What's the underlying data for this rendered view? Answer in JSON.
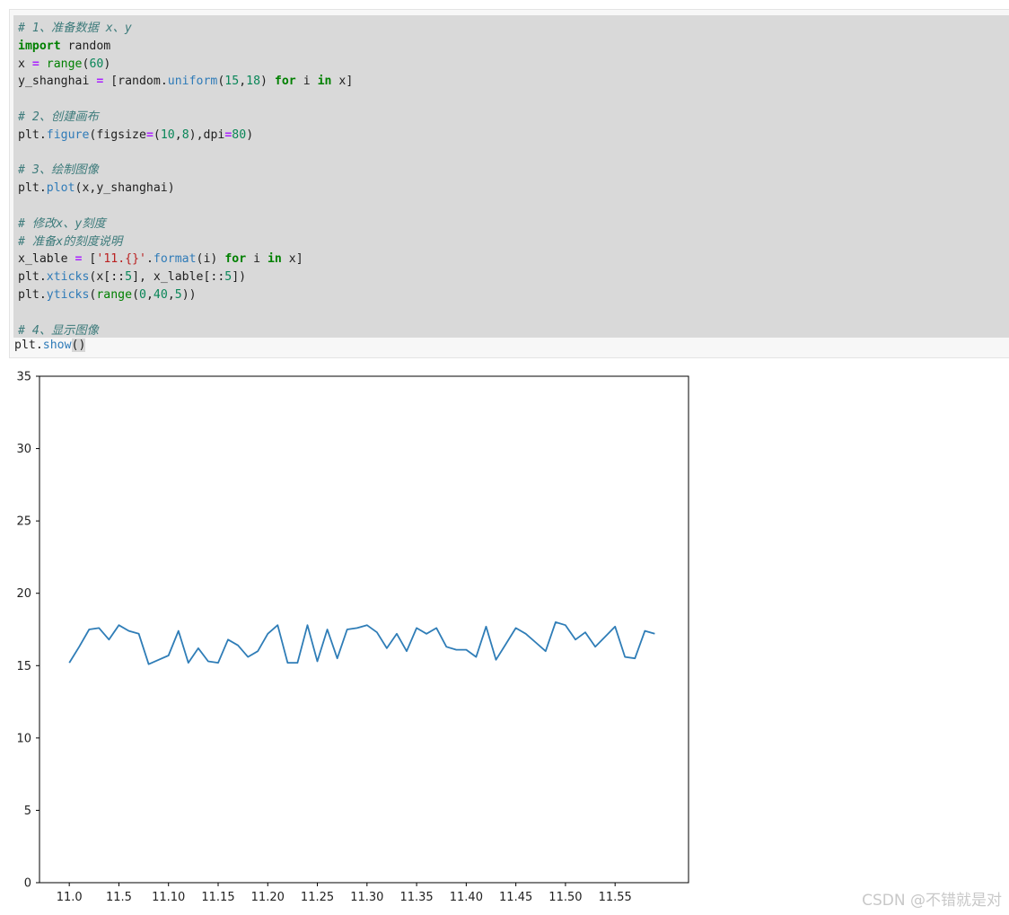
{
  "code_cell": {
    "lines": [
      [
        {
          "c": "com",
          "t": "# 1、准备数据 x、y"
        }
      ],
      [
        {
          "c": "kw",
          "t": "import"
        },
        {
          "c": "txt",
          "t": " random"
        }
      ],
      [
        {
          "c": "txt",
          "t": "x "
        },
        {
          "c": "op",
          "t": "="
        },
        {
          "c": "txt",
          "t": " "
        },
        {
          "c": "kw-plain",
          "t": "range"
        },
        {
          "c": "txt",
          "t": "("
        },
        {
          "c": "num",
          "t": "60"
        },
        {
          "c": "txt",
          "t": ")"
        }
      ],
      [
        {
          "c": "txt",
          "t": "y_shanghai "
        },
        {
          "c": "op",
          "t": "="
        },
        {
          "c": "txt",
          "t": " [random."
        },
        {
          "c": "fn",
          "t": "uniform"
        },
        {
          "c": "txt",
          "t": "("
        },
        {
          "c": "num",
          "t": "15"
        },
        {
          "c": "txt",
          "t": ","
        },
        {
          "c": "num",
          "t": "18"
        },
        {
          "c": "txt",
          "t": ") "
        },
        {
          "c": "kw",
          "t": "for"
        },
        {
          "c": "txt",
          "t": " i "
        },
        {
          "c": "kw",
          "t": "in"
        },
        {
          "c": "txt",
          "t": " x]"
        }
      ],
      [],
      [
        {
          "c": "com",
          "t": "# 2、创建画布"
        }
      ],
      [
        {
          "c": "txt",
          "t": "plt."
        },
        {
          "c": "fn",
          "t": "figure"
        },
        {
          "c": "txt",
          "t": "(figsize"
        },
        {
          "c": "op",
          "t": "="
        },
        {
          "c": "txt",
          "t": "("
        },
        {
          "c": "num",
          "t": "10"
        },
        {
          "c": "txt",
          "t": ","
        },
        {
          "c": "num",
          "t": "8"
        },
        {
          "c": "txt",
          "t": "),dpi"
        },
        {
          "c": "op",
          "t": "="
        },
        {
          "c": "num",
          "t": "80"
        },
        {
          "c": "txt",
          "t": ")"
        }
      ],
      [],
      [
        {
          "c": "com",
          "t": "# 3、绘制图像"
        }
      ],
      [
        {
          "c": "txt",
          "t": "plt."
        },
        {
          "c": "fn",
          "t": "plot"
        },
        {
          "c": "txt",
          "t": "(x,y_shanghai)"
        }
      ],
      [],
      [
        {
          "c": "com",
          "t": "# 修改x、y刻度"
        }
      ],
      [
        {
          "c": "com",
          "t": "# 准备x的刻度说明"
        }
      ],
      [
        {
          "c": "txt",
          "t": "x_lable "
        },
        {
          "c": "op",
          "t": "="
        },
        {
          "c": "txt",
          "t": " ["
        },
        {
          "c": "str",
          "t": "'11.{}'"
        },
        {
          "c": "txt",
          "t": "."
        },
        {
          "c": "fn",
          "t": "format"
        },
        {
          "c": "txt",
          "t": "(i) "
        },
        {
          "c": "kw",
          "t": "for"
        },
        {
          "c": "txt",
          "t": " i "
        },
        {
          "c": "kw",
          "t": "in"
        },
        {
          "c": "txt",
          "t": " x]"
        }
      ],
      [
        {
          "c": "txt",
          "t": "plt."
        },
        {
          "c": "fn",
          "t": "xticks"
        },
        {
          "c": "txt",
          "t": "(x[::"
        },
        {
          "c": "num",
          "t": "5"
        },
        {
          "c": "txt",
          "t": "], x_lable[::"
        },
        {
          "c": "num",
          "t": "5"
        },
        {
          "c": "txt",
          "t": "])"
        }
      ],
      [
        {
          "c": "txt",
          "t": "plt."
        },
        {
          "c": "fn",
          "t": "yticks"
        },
        {
          "c": "txt",
          "t": "("
        },
        {
          "c": "kw-plain",
          "t": "range"
        },
        {
          "c": "txt",
          "t": "("
        },
        {
          "c": "num",
          "t": "0"
        },
        {
          "c": "txt",
          "t": ","
        },
        {
          "c": "num",
          "t": "40"
        },
        {
          "c": "txt",
          "t": ","
        },
        {
          "c": "num",
          "t": "5"
        },
        {
          "c": "txt",
          "t": "))"
        }
      ],
      [],
      [
        {
          "c": "com",
          "t": "# 4、显示图像"
        }
      ]
    ],
    "last_line": [
      {
        "c": "txt",
        "t": "plt."
      },
      {
        "c": "fn",
        "t": "show"
      },
      {
        "c": "bracket",
        "t": "()"
      }
    ]
  },
  "chart_data": {
    "type": "line",
    "title": "",
    "xlabel": "",
    "ylabel": "",
    "x": [
      0,
      1,
      2,
      3,
      4,
      5,
      6,
      7,
      8,
      9,
      10,
      11,
      12,
      13,
      14,
      15,
      16,
      17,
      18,
      19,
      20,
      21,
      22,
      23,
      24,
      25,
      26,
      27,
      28,
      29,
      30,
      31,
      32,
      33,
      34,
      35,
      36,
      37,
      38,
      39,
      40,
      41,
      42,
      43,
      44,
      45,
      46,
      47,
      48,
      49,
      50,
      51,
      52,
      53,
      54,
      55,
      56,
      57,
      58,
      59
    ],
    "series": [
      {
        "color": "#2f7db7",
        "values": [
          15.2,
          16.3,
          17.5,
          17.6,
          16.8,
          17.8,
          17.4,
          17.2,
          15.1,
          15.4,
          15.7,
          17.4,
          15.2,
          16.2,
          15.3,
          15.2,
          16.8,
          16.4,
          15.6,
          16.0,
          17.2,
          17.8,
          15.2,
          15.2,
          17.8,
          15.3,
          17.5,
          15.5,
          17.5,
          17.6,
          17.8,
          17.3,
          16.2,
          17.2,
          16.0,
          17.6,
          17.2,
          17.6,
          16.3,
          16.1,
          16.1,
          15.6,
          17.7,
          15.4,
          16.5,
          17.6,
          17.2,
          16.6,
          16.0,
          18.0,
          17.8,
          16.8,
          17.3,
          16.3,
          17.0,
          17.7,
          15.6,
          15.5,
          17.4,
          17.2
        ]
      }
    ],
    "xticks": {
      "positions": [
        0,
        5,
        10,
        15,
        20,
        25,
        30,
        35,
        40,
        45,
        50,
        55
      ],
      "labels": [
        "11.0",
        "11.5",
        "11.10",
        "11.15",
        "11.20",
        "11.25",
        "11.30",
        "11.35",
        "11.40",
        "11.45",
        "11.50",
        "11.55"
      ]
    },
    "yticks": [
      0,
      5,
      10,
      15,
      20,
      25,
      30,
      35
    ],
    "xlim": [
      -3,
      62.4
    ],
    "ylim": [
      0,
      35
    ],
    "grid": false,
    "legend": "none"
  },
  "watermark": "CSDN @不错就是对"
}
